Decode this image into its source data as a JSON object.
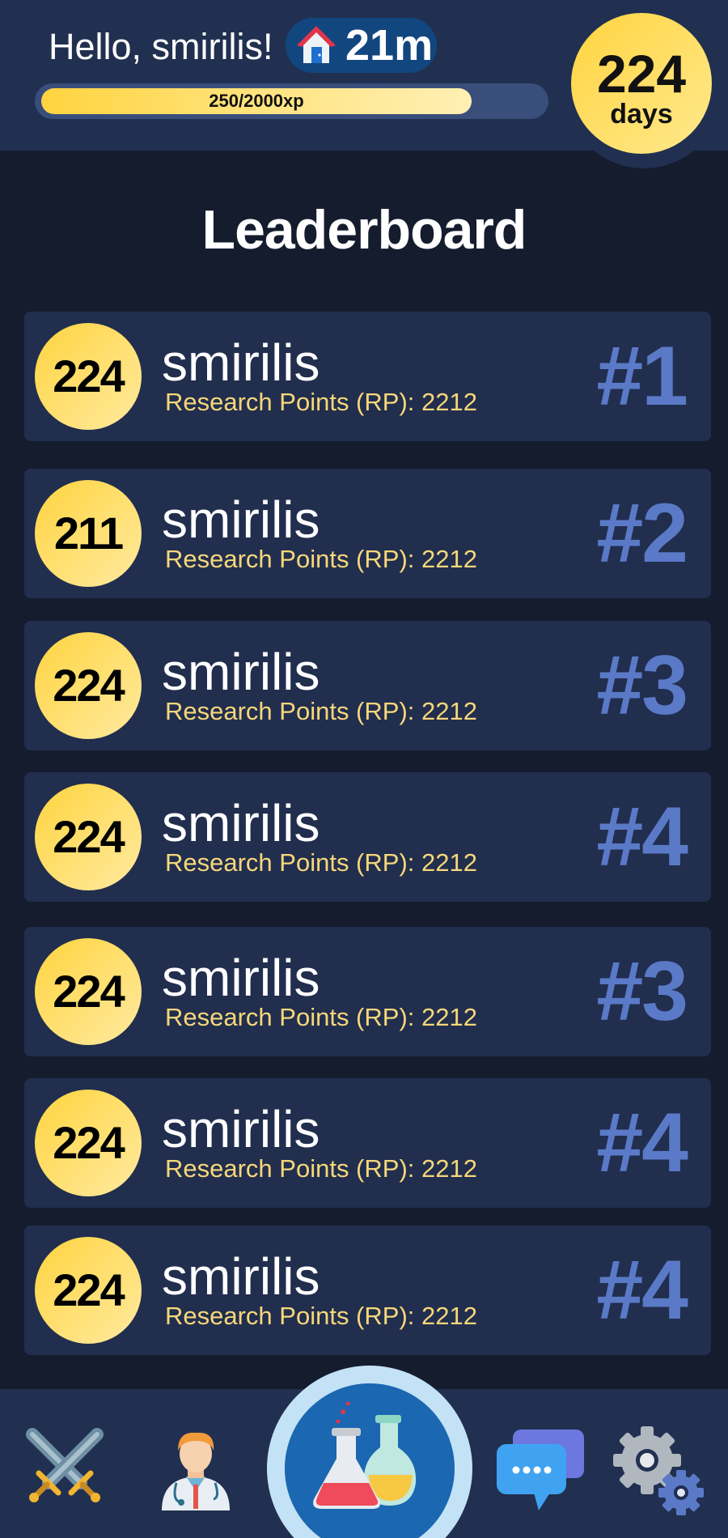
{
  "header": {
    "greeting": "Hello, smirilis!",
    "home_icon": "house-icon",
    "home_time": "21m",
    "xp_label": "250/2000xp",
    "xp_current": 250,
    "xp_max": 2000,
    "streak_number": "224",
    "streak_unit": "days"
  },
  "title": "Leaderboard",
  "leaderboard": [
    {
      "level": "224",
      "name": "smirilis",
      "points": "Research Points (RP): 2212",
      "rank": "#1"
    },
    {
      "level": "211",
      "name": "smirilis",
      "points": "Research Points (RP): 2212",
      "rank": "#2"
    },
    {
      "level": "224",
      "name": "smirilis",
      "points": "Research Points (RP): 2212",
      "rank": "#3"
    },
    {
      "level": "224",
      "name": "smirilis",
      "points": "Research Points (RP): 2212",
      "rank": "#4"
    },
    {
      "level": "224",
      "name": "smirilis",
      "points": "Research Points (RP): 2212",
      "rank": "#3"
    },
    {
      "level": "224",
      "name": "smirilis",
      "points": "Research Points (RP): 2212",
      "rank": "#4"
    },
    {
      "level": "224",
      "name": "smirilis",
      "points": "Research Points (RP): 2212",
      "rank": "#4"
    }
  ],
  "nav": {
    "items": [
      {
        "icon": "crossed-swords-icon"
      },
      {
        "icon": "doctor-icon"
      },
      {
        "icon": "lab-flasks-icon",
        "active": true
      },
      {
        "icon": "chat-bubbles-icon"
      },
      {
        "icon": "gears-icon"
      }
    ]
  },
  "colors": {
    "header_bg": "#213050",
    "page_bg": "#141c2e",
    "card_bg": "#212e4e",
    "gold": "#ffd43f",
    "rank_blue": "#5a7ac8",
    "points_text": "#f7d77a"
  }
}
